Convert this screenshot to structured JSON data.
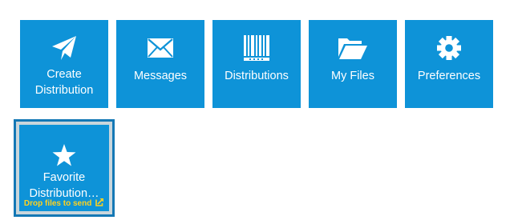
{
  "tiles": [
    {
      "label_line1": "Create",
      "label_line2": "Distribution",
      "icon": "paper-plane-icon"
    },
    {
      "label": "Messages",
      "icon": "envelope-icon"
    },
    {
      "label": "Distributions",
      "icon": "barcode-icon"
    },
    {
      "label": "My Files",
      "icon": "folder-open-icon"
    },
    {
      "label": "Preferences",
      "icon": "gear-icon"
    }
  ],
  "favorite": {
    "label_line1": "Favorite",
    "label_line2": "Distribution…",
    "drop_text": "Drop files to send",
    "icon": "star-icon",
    "drop_icon": "external-link-icon",
    "drop_color": "#ffd21f"
  },
  "colors": {
    "tile_bg": "#0e93d8",
    "selected_border": "#1478b5"
  }
}
